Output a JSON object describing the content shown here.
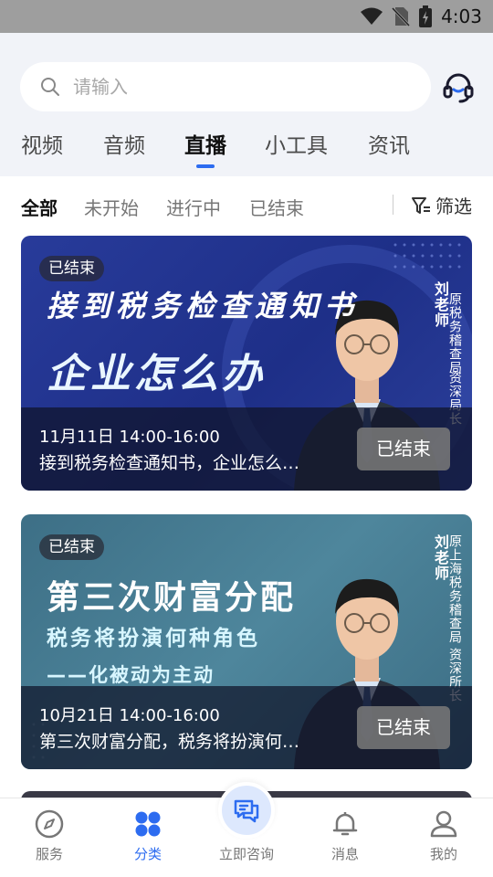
{
  "status_bar": {
    "time": "4:03"
  },
  "search": {
    "placeholder": "请输入"
  },
  "tabs": [
    {
      "label": "视频"
    },
    {
      "label": "音频"
    },
    {
      "label": "直播",
      "active": true
    },
    {
      "label": "小工具"
    },
    {
      "label": "资讯"
    }
  ],
  "filters": {
    "options": [
      {
        "label": "全部",
        "active": true
      },
      {
        "label": "未开始"
      },
      {
        "label": "进行中"
      },
      {
        "label": "已结束"
      }
    ],
    "filter_button": "筛选"
  },
  "live_cards": [
    {
      "badge": "已结束",
      "banner_lines": [
        "接到税务检查通知书",
        "企业怎么办"
      ],
      "speaker_name": "刘老师",
      "speaker_title": [
        "原税务稽查局",
        "资深局长"
      ],
      "time": "11月11日 14:00-16:00",
      "title": "接到税务检查通知书，企业怎么…",
      "status_button": "已结束"
    },
    {
      "badge": "已结束",
      "banner_lines": [
        "第三次财富分配",
        "税务将扮演何种角色",
        "——化被动为主动"
      ],
      "speaker_name": "刘老师",
      "speaker_title": [
        "原上海税务稽查局",
        "资深所长"
      ],
      "time": "10月21日 14:00-16:00",
      "title": "第三次财富分配，税务将扮演何…",
      "status_button": "已结束"
    }
  ],
  "bottom_nav": [
    {
      "label": "服务",
      "icon": "compass-icon"
    },
    {
      "label": "分类",
      "icon": "grid-icon",
      "active": true
    },
    {
      "label": "立即咨询",
      "icon": "chat-icon"
    },
    {
      "label": "消息",
      "icon": "bell-icon"
    },
    {
      "label": "我的",
      "icon": "user-icon"
    }
  ],
  "colors": {
    "accent": "#2d6cf0",
    "header_bg": "#f1f3f8",
    "card1_bg": "#243693",
    "card2_bg": "#467c93"
  }
}
